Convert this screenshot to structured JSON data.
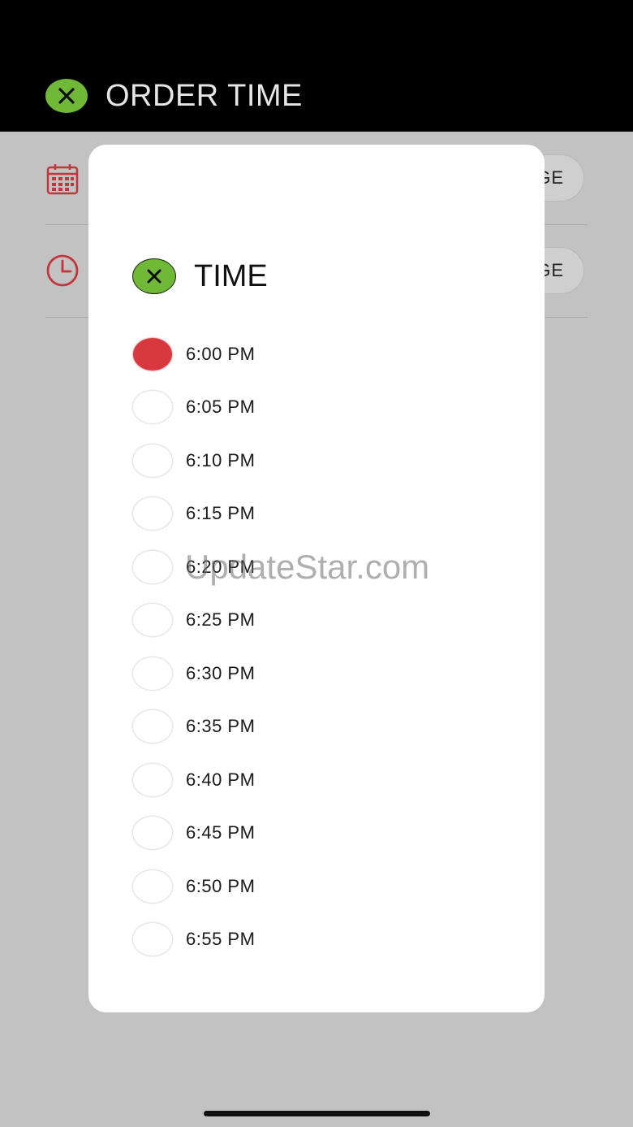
{
  "header": {
    "title": "ORDER TIME",
    "close_icon": "close-x-icon",
    "accent": "#6fb936"
  },
  "background_rows": [
    {
      "icon": "calendar-icon",
      "button_label": "GE"
    },
    {
      "icon": "clock-icon",
      "button_label": "GE"
    }
  ],
  "dialog": {
    "title": "TIME",
    "close_icon": "close-x-icon",
    "selected_index": 0,
    "selected_color": "#d7393f",
    "options": [
      {
        "label": "6:00 PM"
      },
      {
        "label": "6:05 PM"
      },
      {
        "label": "6:10 PM"
      },
      {
        "label": "6:15 PM"
      },
      {
        "label": "6:20 PM"
      },
      {
        "label": "6:25 PM"
      },
      {
        "label": "6:30 PM"
      },
      {
        "label": "6:35 PM"
      },
      {
        "label": "6:40 PM"
      },
      {
        "label": "6:45 PM"
      },
      {
        "label": "6:50 PM"
      },
      {
        "label": "6:55 PM"
      }
    ]
  },
  "watermark": "UpdateStar.com"
}
